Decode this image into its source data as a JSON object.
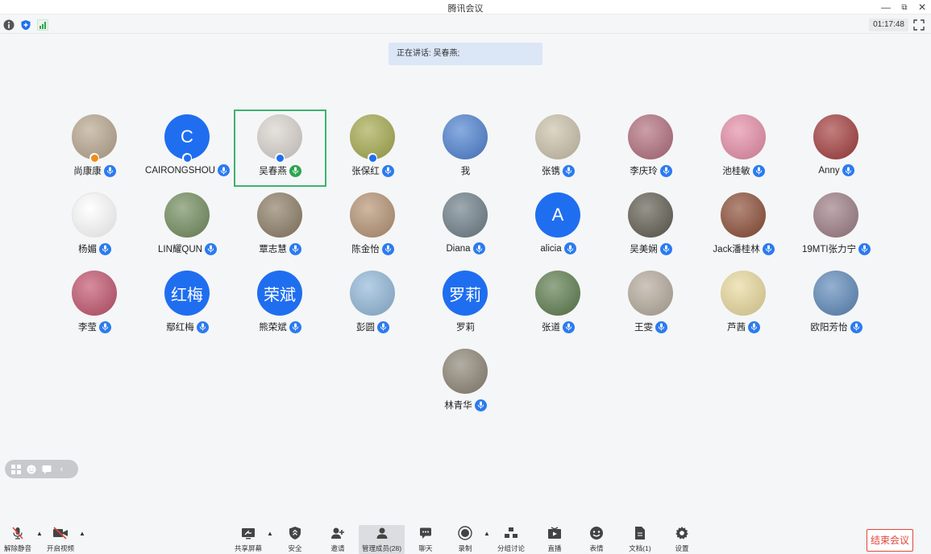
{
  "window": {
    "title": "腾讯会议",
    "minimize": "—",
    "restore": "⧉",
    "close": "✕"
  },
  "infobar": {
    "timer": "01:17:48"
  },
  "speaking": {
    "text": "正在讲话: 吴春燕;"
  },
  "participants": [
    {
      "name": "尚康康",
      "avatar_text": "",
      "bg": "#b6a48c",
      "badge": "#f08c1a",
      "mic": true
    },
    {
      "name": "CAIRONGSHOU",
      "avatar_text": "C",
      "bg": "#1f6ef0",
      "badge": "#1f6ef0",
      "mic": true
    },
    {
      "name": "吴春燕",
      "avatar_text": "",
      "bg": "#d8d2cc",
      "badge": "#1f6ef0",
      "mic": true,
      "active": true
    },
    {
      "name": "张保红",
      "avatar_text": "",
      "bg": "#a3a84a",
      "badge": "#1f6ef0",
      "mic": true
    },
    {
      "name": "我",
      "avatar_text": "",
      "bg": "#4a7fd0",
      "badge": "",
      "mic": false
    },
    {
      "name": "张镌",
      "avatar_text": "",
      "bg": "#c9c0a8",
      "badge": "",
      "mic": true
    },
    {
      "name": "李庆玲",
      "avatar_text": "",
      "bg": "#b06b7a",
      "badge": "",
      "mic": true
    },
    {
      "name": "池桂敏",
      "avatar_text": "",
      "bg": "#e58aa6",
      "badge": "",
      "mic": true
    },
    {
      "name": "Anny",
      "avatar_text": "",
      "bg": "#a23a3a",
      "badge": "",
      "mic": true
    },
    {
      "name": "杨媚",
      "avatar_text": "",
      "bg": "#ffffff",
      "badge": "",
      "mic": true
    },
    {
      "name": "LIN耀QUN",
      "avatar_text": "",
      "bg": "#6f8a5a",
      "badge": "",
      "mic": true
    },
    {
      "name": "覃志慧",
      "avatar_text": "",
      "bg": "#8a7a62",
      "badge": "",
      "mic": true
    },
    {
      "name": "陈金怡",
      "avatar_text": "",
      "bg": "#b49070",
      "badge": "",
      "mic": true
    },
    {
      "name": "Diana",
      "avatar_text": "",
      "bg": "#6b7c86",
      "badge": "",
      "mic": true
    },
    {
      "name": "alicia",
      "avatar_text": "A",
      "bg": "#1f6ef0",
      "badge": "",
      "mic": true
    },
    {
      "name": "吴美娴",
      "avatar_text": "",
      "bg": "#5e5a4e",
      "badge": "",
      "mic": true
    },
    {
      "name": "Jack潘桂林",
      "avatar_text": "",
      "bg": "#8a4a32",
      "badge": "",
      "mic": true
    },
    {
      "name": "19MTI张力宁",
      "avatar_text": "",
      "bg": "#9a7a82",
      "badge": "",
      "mic": true
    },
    {
      "name": "李莹",
      "avatar_text": "",
      "bg": "#c0506a",
      "badge": "",
      "mic": true
    },
    {
      "name": "鄢红梅",
      "avatar_text": "红梅",
      "bg": "#1f6ef0",
      "badge": "",
      "mic": true
    },
    {
      "name": "熊荣斌",
      "avatar_text": "荣斌",
      "bg": "#1f6ef0",
      "badge": "",
      "mic": true
    },
    {
      "name": "彭圆",
      "avatar_text": "",
      "bg": "#8fb6d8",
      "badge": "",
      "mic": true
    },
    {
      "name": "罗莉",
      "avatar_text": "罗莉",
      "bg": "#1f6ef0",
      "badge": "",
      "mic": false
    },
    {
      "name": "张道",
      "avatar_text": "",
      "bg": "#5a7a4a",
      "badge": "",
      "mic": true
    },
    {
      "name": "王雯",
      "avatar_text": "",
      "bg": "#b4a89a",
      "badge": "",
      "mic": true
    },
    {
      "name": "芦茜",
      "avatar_text": "",
      "bg": "#e8d89a",
      "badge": "",
      "mic": true
    },
    {
      "name": "欧阳芳怡",
      "avatar_text": "",
      "bg": "#5a86b8",
      "badge": "",
      "mic": true
    },
    {
      "name": "林青华",
      "avatar_text": "",
      "bg": "#8a8272",
      "badge": "",
      "mic": true
    }
  ],
  "toolbar": {
    "unmute": "解除静音",
    "video": "开启视频",
    "share": "共享屏幕",
    "security": "安全",
    "invite": "邀请",
    "members": "管理成员(28)",
    "chat": "聊天",
    "record": "录制",
    "breakout": "分组讨论",
    "live": "直播",
    "reactions": "表情",
    "docs": "文档(1)",
    "settings": "设置",
    "end": "结束会议"
  },
  "colors": {
    "accent": "#2b7bf0",
    "active_border": "#3cb371",
    "end_red": "#e0463a"
  }
}
